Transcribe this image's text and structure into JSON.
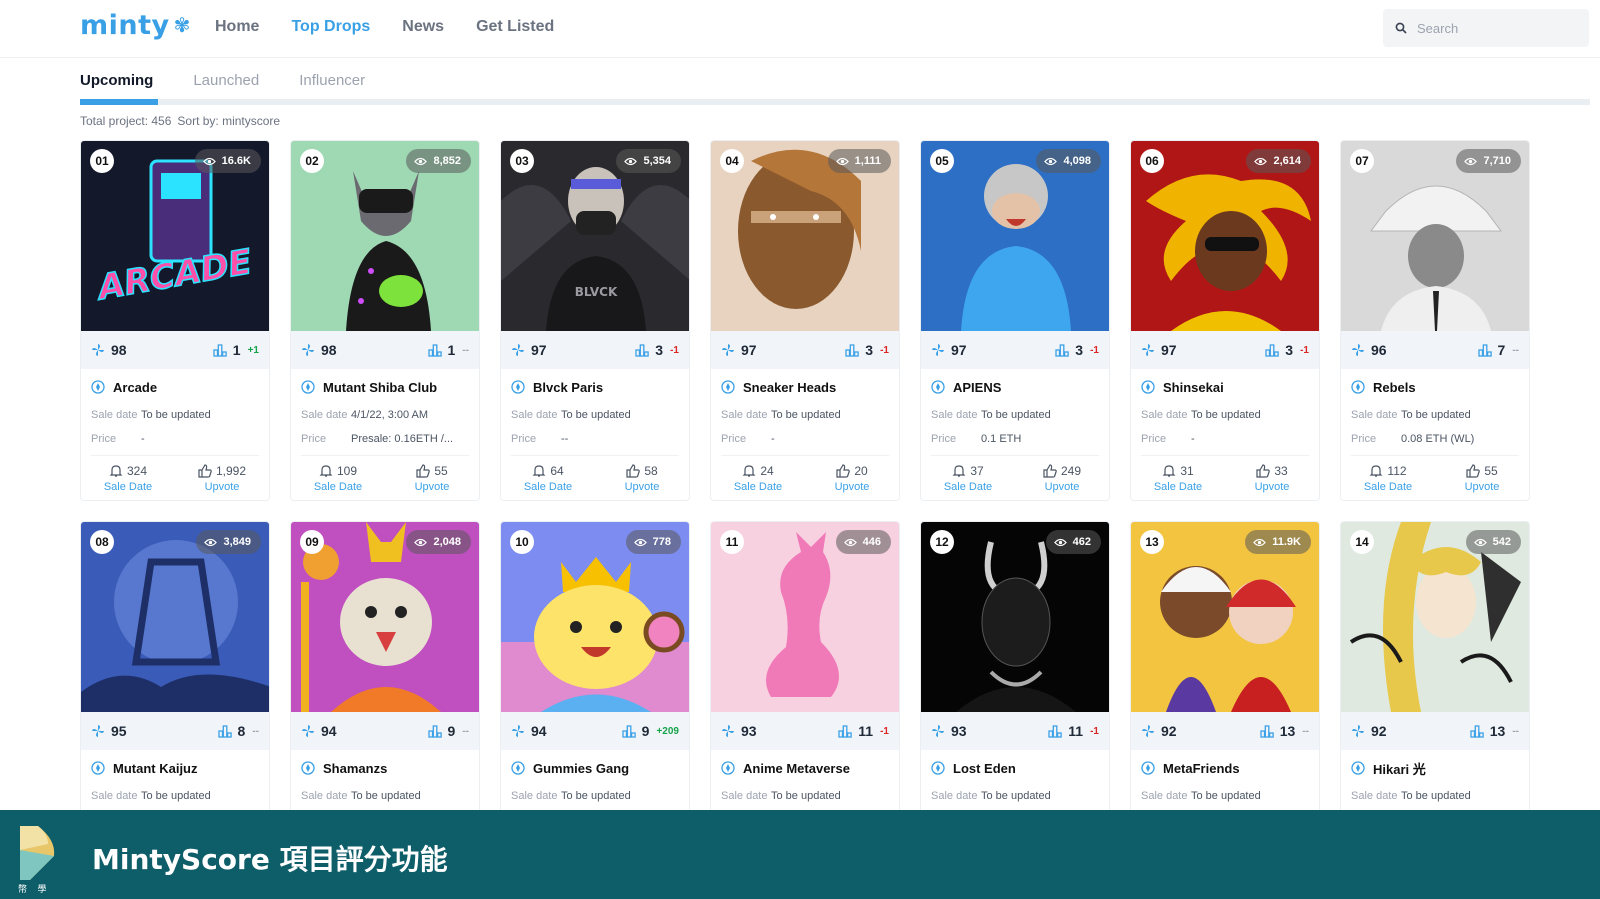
{
  "brand": {
    "name": "minty",
    "accent": "#3aa0e6"
  },
  "nav": {
    "items": [
      {
        "label": "Home",
        "active": false
      },
      {
        "label": "Top Drops",
        "active": true
      },
      {
        "label": "News",
        "active": false
      },
      {
        "label": "Get Listed",
        "active": false
      }
    ]
  },
  "search": {
    "placeholder": "Search",
    "value": ""
  },
  "tabs": [
    {
      "label": "Upcoming",
      "active": true
    },
    {
      "label": "Launched",
      "active": false
    },
    {
      "label": "Influencer",
      "active": false
    }
  ],
  "summary": {
    "total": "Total project: 456",
    "sort": "Sort by: mintyscore"
  },
  "labels": {
    "sale_date": "Sale date",
    "price": "Price",
    "sale_date_stat": "Sale Date",
    "upvote": "Upvote"
  },
  "projects": [
    {
      "rank": "01",
      "views": "16.6K",
      "score": "98",
      "rank_votes": "1",
      "change": "+1",
      "change_type": "pos",
      "name": "Arcade",
      "sale_date": "To be updated",
      "price": "-",
      "alerts": "324",
      "upvotes": "1,992"
    },
    {
      "rank": "02",
      "views": "8,852",
      "score": "98",
      "rank_votes": "1",
      "change": "--",
      "change_type": "flat",
      "name": "Mutant Shiba Club",
      "sale_date": "4/1/22, 3:00 AM",
      "price": "Presale: 0.16ETH /...",
      "alerts": "109",
      "upvotes": "55"
    },
    {
      "rank": "03",
      "views": "5,354",
      "score": "97",
      "rank_votes": "3",
      "change": "-1",
      "change_type": "neg",
      "name": "Blvck Paris",
      "sale_date": "To be updated",
      "price": "--",
      "alerts": "64",
      "upvotes": "58"
    },
    {
      "rank": "04",
      "views": "1,111",
      "score": "97",
      "rank_votes": "3",
      "change": "-1",
      "change_type": "neg",
      "name": "Sneaker Heads",
      "sale_date": "To be updated",
      "price": "-",
      "alerts": "24",
      "upvotes": "20"
    },
    {
      "rank": "05",
      "views": "4,098",
      "score": "97",
      "rank_votes": "3",
      "change": "-1",
      "change_type": "neg",
      "name": "APIENS",
      "sale_date": "To be updated",
      "price": "0.1 ETH",
      "alerts": "37",
      "upvotes": "249"
    },
    {
      "rank": "06",
      "views": "2,614",
      "score": "97",
      "rank_votes": "3",
      "change": "-1",
      "change_type": "neg",
      "name": "Shinsekai",
      "sale_date": "To be updated",
      "price": "-",
      "alerts": "31",
      "upvotes": "33"
    },
    {
      "rank": "07",
      "views": "7,710",
      "score": "96",
      "rank_votes": "7",
      "change": "--",
      "change_type": "flat",
      "name": "Rebels",
      "sale_date": "To be updated",
      "price": "0.08 ETH (WL)",
      "alerts": "112",
      "upvotes": "55"
    },
    {
      "rank": "08",
      "views": "3,849",
      "score": "95",
      "rank_votes": "8",
      "change": "--",
      "change_type": "flat",
      "name": "Mutant Kaijuz",
      "sale_date": "To be updated"
    },
    {
      "rank": "09",
      "views": "2,048",
      "score": "94",
      "rank_votes": "9",
      "change": "--",
      "change_type": "flat",
      "name": "Shamanzs",
      "sale_date": "To be updated"
    },
    {
      "rank": "10",
      "views": "778",
      "score": "94",
      "rank_votes": "9",
      "change": "+209",
      "change_type": "pos",
      "name": "Gummies Gang",
      "sale_date": "To be updated"
    },
    {
      "rank": "11",
      "views": "446",
      "score": "93",
      "rank_votes": "11",
      "change": "-1",
      "change_type": "neg",
      "name": "Anime Metaverse",
      "sale_date": "To be updated"
    },
    {
      "rank": "12",
      "views": "462",
      "score": "93",
      "rank_votes": "11",
      "change": "-1",
      "change_type": "neg",
      "name": "Lost Eden",
      "sale_date": "To be updated"
    },
    {
      "rank": "13",
      "views": "11.9K",
      "score": "92",
      "rank_votes": "13",
      "change": "--",
      "change_type": "flat",
      "name": "MetaFriends",
      "sale_date": "To be updated"
    },
    {
      "rank": "14",
      "views": "542",
      "score": "92",
      "rank_votes": "13",
      "change": "--",
      "change_type": "flat",
      "name": "Hikari 光",
      "sale_date": "To be updated"
    }
  ],
  "banner": {
    "title": "MintyScore 項目評分功能",
    "caption": "幣 學",
    "color": "#0e5e69"
  }
}
